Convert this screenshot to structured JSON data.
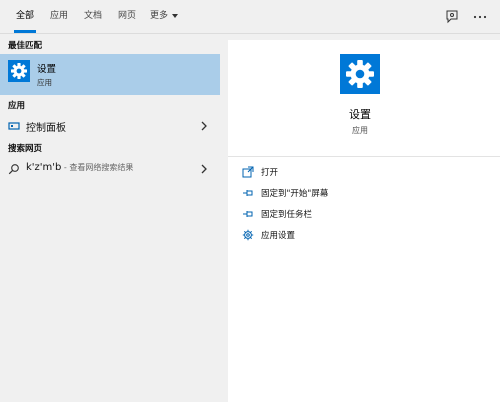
{
  "tabs": [
    {
      "label": "全部",
      "active": true
    },
    {
      "label": "应用",
      "active": false
    },
    {
      "label": "文档",
      "active": false
    },
    {
      "label": "网页",
      "active": false
    },
    {
      "label": "更多",
      "active": false
    }
  ],
  "topbar_icons": [
    "feedback-icon",
    "more-options-icon"
  ],
  "left": {
    "best_match_header": "最佳匹配",
    "best_match": {
      "title": "设置",
      "subtitle": "应用",
      "icon": "gear-icon"
    },
    "apps_header": "应用",
    "apps": [
      {
        "label": "控制面板",
        "icon": "control-panel-icon"
      }
    ],
    "web_header": "搜索网页",
    "web": {
      "query": "k'z'm'b",
      "suffix": " - 查看网络搜索结果",
      "icon": "search-icon"
    }
  },
  "right": {
    "title": "设置",
    "kind": "应用",
    "actions": [
      {
        "label": "打开",
        "icon": "open-icon"
      },
      {
        "label": "固定到\"开始\"屏幕",
        "icon": "pin-icon"
      },
      {
        "label": "固定到任务栏",
        "icon": "pin-icon"
      },
      {
        "label": "应用设置",
        "icon": "gear-icon"
      }
    ]
  },
  "colors": {
    "accent": "#0078d7",
    "selection": "#aacde9",
    "background": "#f0f0f0"
  }
}
